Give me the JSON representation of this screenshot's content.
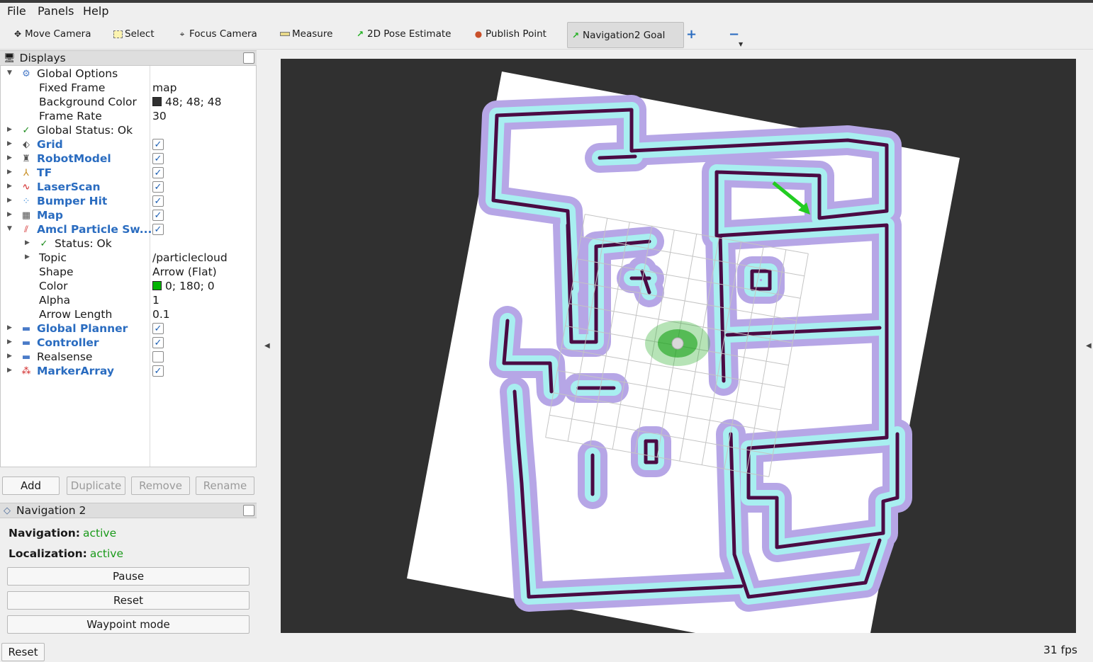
{
  "menu": [
    "File",
    "Panels",
    "Help"
  ],
  "toolbar": {
    "move_camera": "Move Camera",
    "select": "Select",
    "focus_camera": "Focus Camera",
    "measure": "Measure",
    "pose_estimate": "2D Pose Estimate",
    "publish_point": "Publish Point",
    "nav_goal": "Navigation2 Goal"
  },
  "displays": {
    "title": "Displays",
    "global_options": "Global Options",
    "fixed_frame_label": "Fixed Frame",
    "fixed_frame_value": "map",
    "bg_color_label": "Background Color",
    "bg_color_value": "48; 48; 48",
    "bg_color_hex": "#303030",
    "frame_rate_label": "Frame Rate",
    "frame_rate_value": "30",
    "global_status": "Global Status: Ok",
    "items": [
      "Grid",
      "RobotModel",
      "TF",
      "LaserScan",
      "Bumper Hit",
      "Map",
      "Amcl Particle Sw..."
    ],
    "amcl": {
      "status": "Status: Ok",
      "topic_label": "Topic",
      "topic_value": "/particlecloud",
      "shape_label": "Shape",
      "shape_value": "Arrow (Flat)",
      "color_label": "Color",
      "color_value": "0; 180; 0",
      "color_hex": "#00b400",
      "alpha_label": "Alpha",
      "alpha_value": "1",
      "arrow_length_label": "Arrow Length",
      "arrow_length_value": "0.1"
    },
    "more_items": [
      "Global Planner",
      "Controller",
      "Realsense",
      "MarkerArray"
    ],
    "buttons": {
      "add": "Add",
      "duplicate": "Duplicate",
      "remove": "Remove",
      "rename": "Rename"
    }
  },
  "navigation": {
    "title": "Navigation 2",
    "navigation_label": "Navigation:",
    "navigation_value": "active",
    "localization_label": "Localization:",
    "localization_value": "active",
    "pause": "Pause",
    "reset": "Reset",
    "waypoint": "Waypoint mode"
  },
  "footer": {
    "reset": "Reset",
    "fps": "31 fps"
  }
}
